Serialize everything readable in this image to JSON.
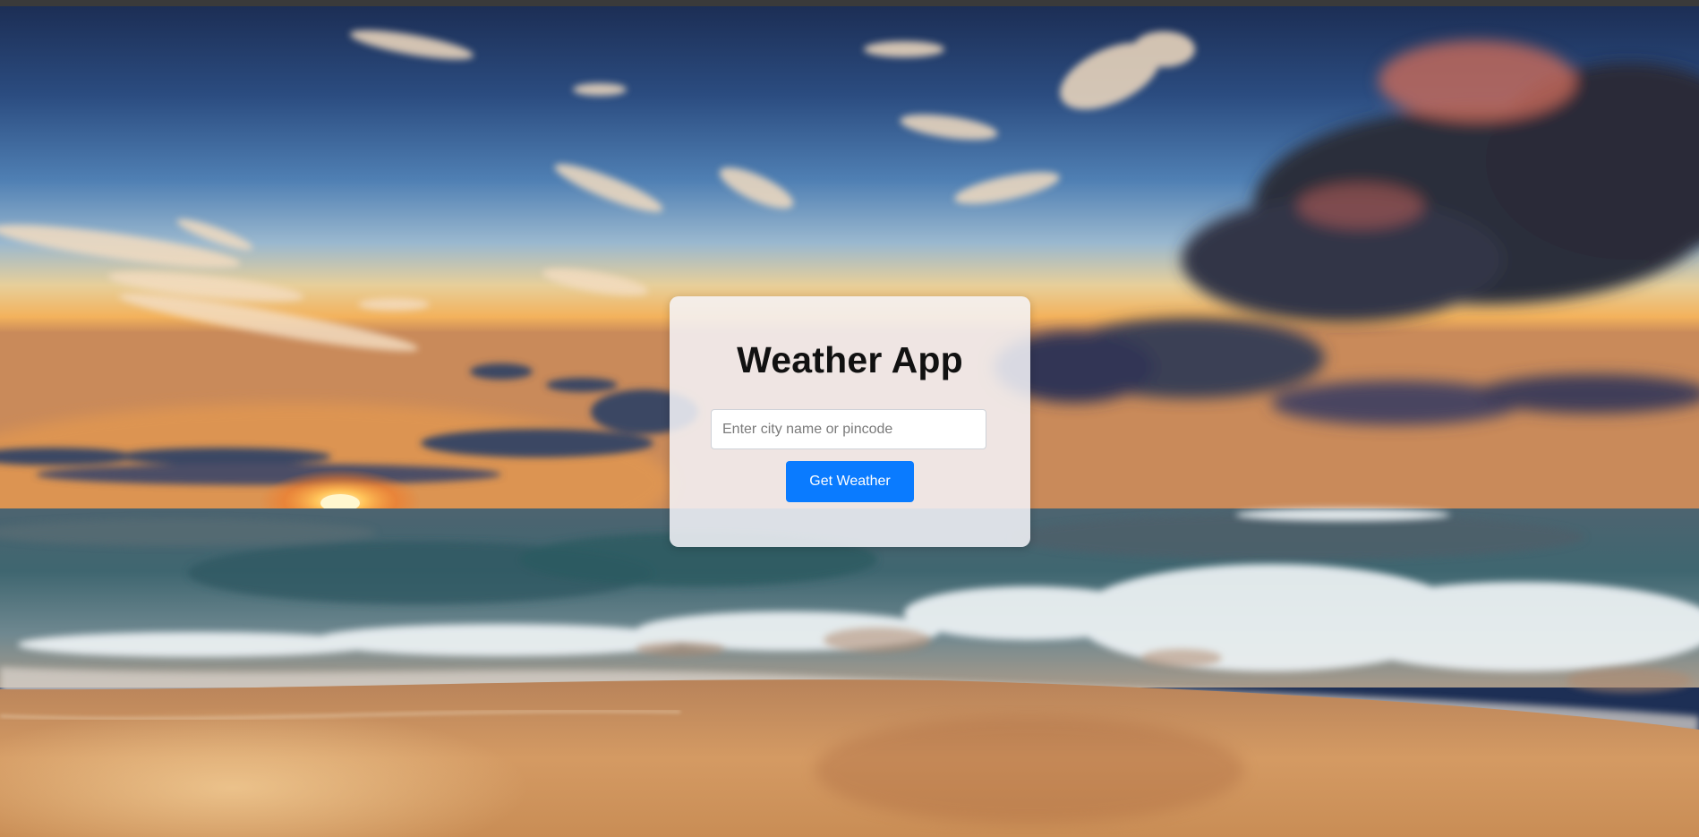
{
  "background": {
    "scene": "beach-sunset-photo"
  },
  "card": {
    "title": "Weather App",
    "search": {
      "placeholder": "Enter city name or pincode",
      "value": ""
    },
    "submit_label": "Get Weather"
  },
  "colors": {
    "button": "#0a7bff",
    "card_background": "#f4f5f9",
    "title_text": "#111111"
  }
}
